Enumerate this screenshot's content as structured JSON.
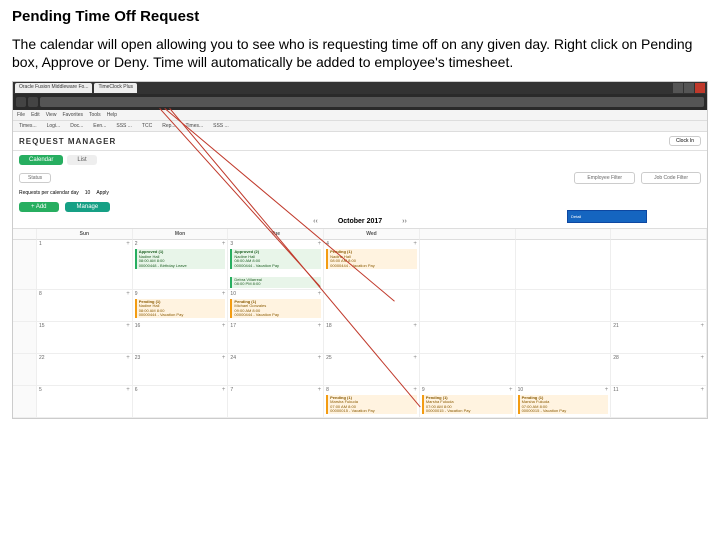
{
  "page": {
    "title": "Pending Time Off Request",
    "instructions": "The calendar will open allowing you to see who is requesting time off on any given day. Right click on Pending box, Approve or Deny. Time will automatically be added to employee's timesheet."
  },
  "browser": {
    "tabs": [
      "Oracle Fusion Middleware Fo...",
      "TimeClock Plus"
    ]
  },
  "menu": [
    "File",
    "Edit",
    "View",
    "Favorites",
    "Tools",
    "Help"
  ],
  "toolbar": [
    "Times...",
    "Logi...",
    "Doc...",
    "Een...",
    "SSS ...",
    "TCC",
    "Rep...",
    "Times...",
    "SSS ..."
  ],
  "app": {
    "title": "REQUEST MANAGER",
    "clock": "Clock In",
    "tabs": {
      "calendar": "Calendar",
      "list": "List"
    },
    "status": "Status",
    "requestsPer": "Requests per calendar day",
    "requestsPerVal": "10",
    "apply": "Apply",
    "empFilter": "Employee Filter",
    "jobFilter": "Job Code Filter",
    "add": "+ Add",
    "manage": "Manage",
    "navPrev": "‹‹",
    "navNext": "››",
    "month": "October 2017"
  },
  "days": [
    "Sun",
    "Mon",
    "Tue",
    "Wed",
    "",
    "",
    ""
  ],
  "weeks": [
    {
      "num": "",
      "cells": [
        {
          "d": "1"
        },
        {
          "d": "2",
          "events": [
            {
              "kind": "approved",
              "title": "Approved (1)",
              "who": "Nadine Hall",
              "time": "08:00 AM 8:00",
              "code": "00000448 - Birthday Leave"
            }
          ]
        },
        {
          "d": "3",
          "events": [
            {
              "kind": "approved",
              "title": "Approved (2)",
              "who": "Nadine Hall",
              "time": "08:00 AM 8:00",
              "code": "00000444 - Vacation Pay"
            },
            {
              "kind": "approved",
              "title": "",
              "who": "Debra Villarreal",
              "time": "08:00 PM 8:00",
              "code": ""
            }
          ]
        },
        {
          "d": "4",
          "events": [
            {
              "kind": "pending",
              "title": "Pending (1)",
              "who": "Nadine Hall",
              "time": "08:00 AM 8:00",
              "code": "00000444 - Vacation Pay"
            }
          ]
        },
        {
          "d": ""
        },
        {
          "d": ""
        },
        {
          "d": ""
        }
      ]
    },
    {
      "num": "",
      "cells": [
        {
          "d": "8"
        },
        {
          "d": "9",
          "events": [
            {
              "kind": "pending",
              "title": "Pending (1)",
              "who": "Nadine Hall",
              "time": "08:00 AM 8:00",
              "code": "00000444 - Vacation Pay"
            }
          ]
        },
        {
          "d": "10",
          "events": [
            {
              "kind": "pending",
              "title": "Pending (1)",
              "who": "Michael Gonzales",
              "time": "09:00 AM 8:00",
              "code": "00000444 - Vacation Pay"
            }
          ]
        },
        {
          "d": ""
        },
        {
          "d": ""
        },
        {
          "d": ""
        },
        {
          "d": ""
        }
      ]
    },
    {
      "num": "",
      "cells": [
        {
          "d": "15"
        },
        {
          "d": "16"
        },
        {
          "d": "17"
        },
        {
          "d": "18"
        },
        {
          "d": ""
        },
        {
          "d": ""
        },
        {
          "d": "21"
        }
      ]
    },
    {
      "num": "",
      "cells": [
        {
          "d": "22"
        },
        {
          "d": "23"
        },
        {
          "d": "24"
        },
        {
          "d": "25"
        },
        {
          "d": ""
        },
        {
          "d": ""
        },
        {
          "d": "28"
        }
      ]
    },
    {
      "num": "",
      "cells": [
        {
          "d": "5"
        },
        {
          "d": "6"
        },
        {
          "d": "7"
        },
        {
          "d": "8",
          "events": [
            {
              "kind": "pending",
              "title": "Pending (1)",
              "who": "Marsha Fukuda",
              "time": "07:00 AM 8:00",
              "code": "00000015 - Vacation Pay"
            }
          ]
        },
        {
          "d": "9",
          "events": [
            {
              "kind": "pending",
              "title": "Pending (1)",
              "who": "Marsha Fukuda",
              "time": "07:00 AM 8:00",
              "code": "00000015 - Vacation Pay"
            }
          ]
        },
        {
          "d": "10",
          "events": [
            {
              "kind": "pending",
              "title": "Pending (1)",
              "who": "Marsha Fukuda",
              "time": "07:00 AM 8:00",
              "code": "00000015 - Vacation Pay"
            }
          ]
        },
        {
          "d": "11"
        }
      ]
    }
  ]
}
